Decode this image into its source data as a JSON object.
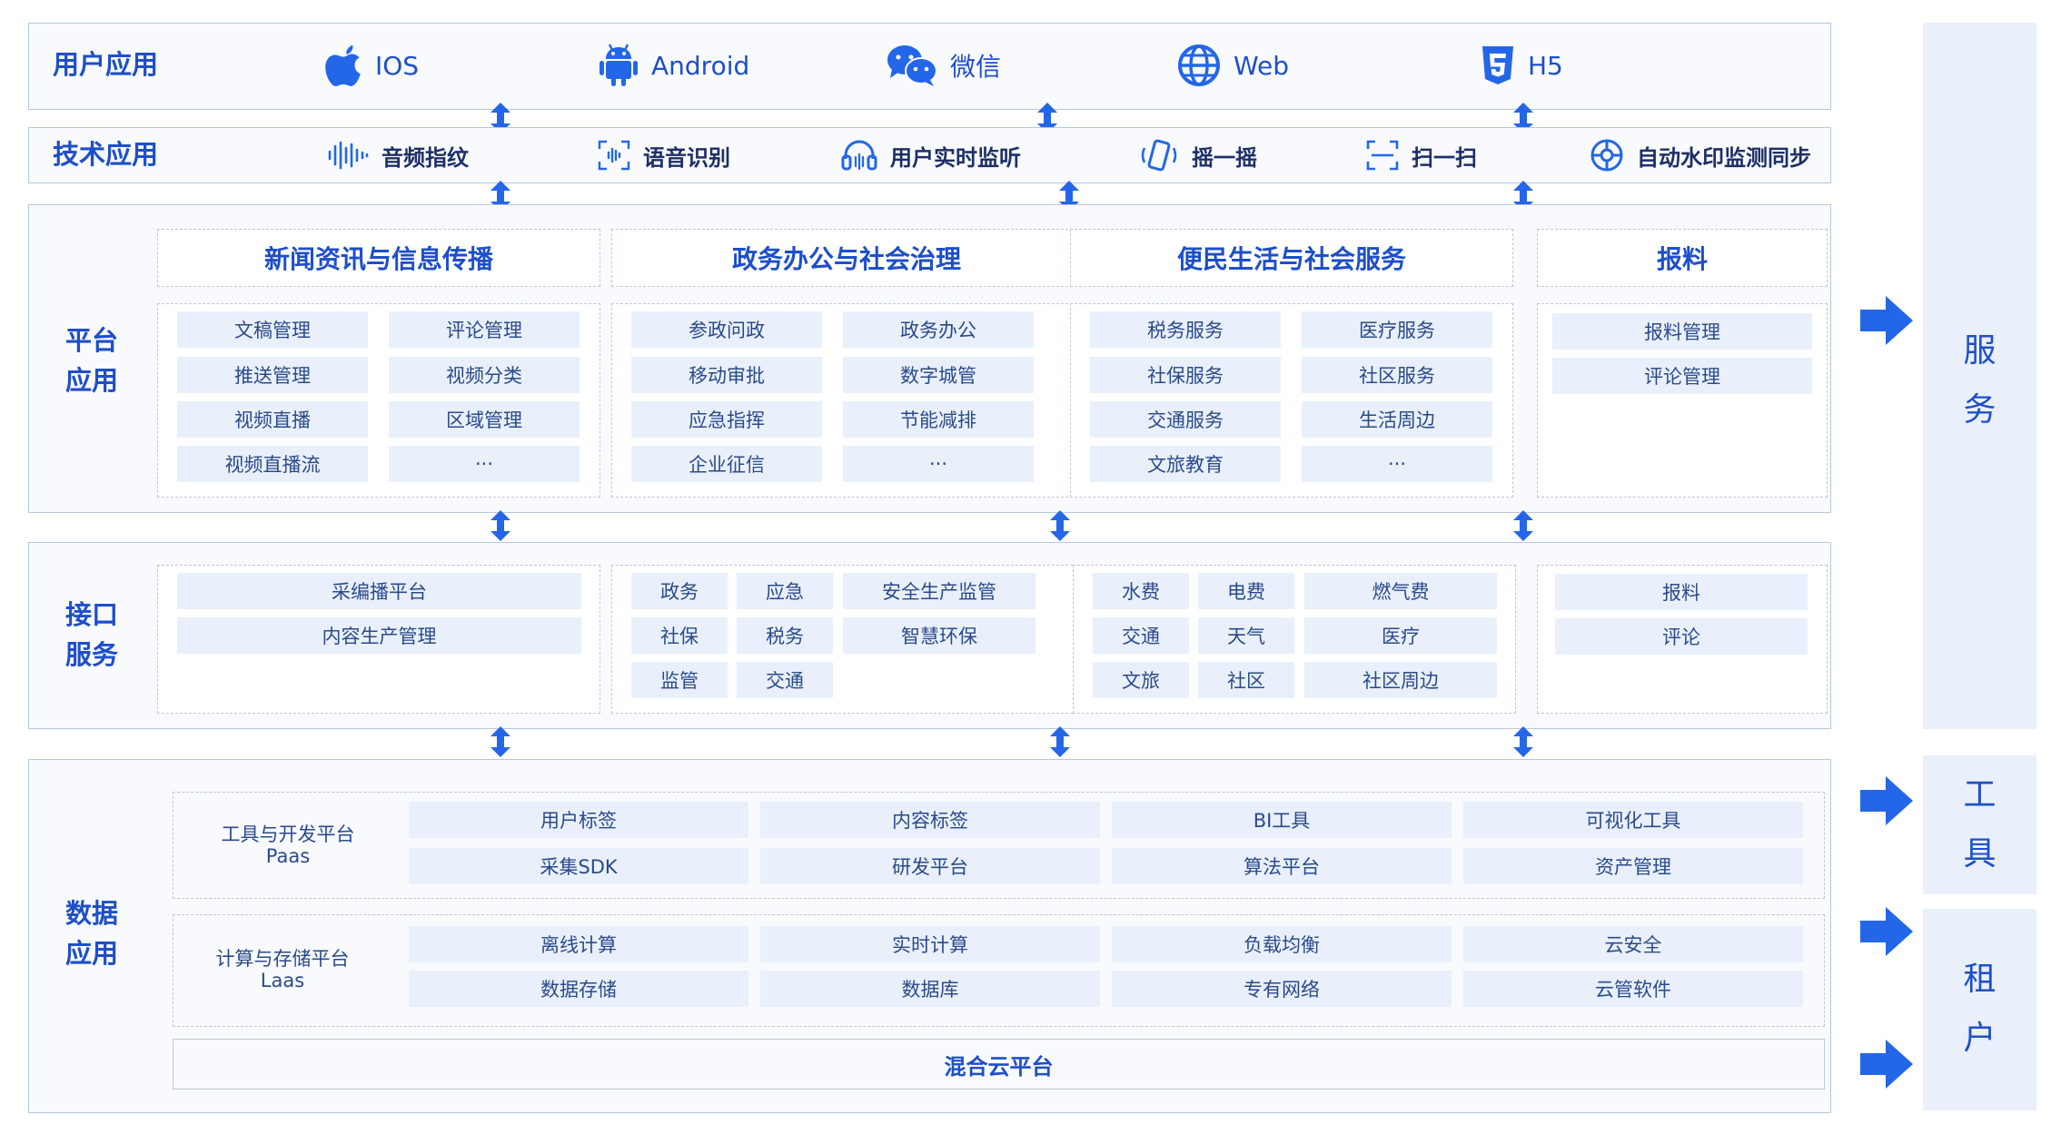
{
  "rows": {
    "user_app": {
      "label": "用户应用",
      "items": [
        {
          "icon": "apple-icon",
          "label": "IOS"
        },
        {
          "icon": "android-icon",
          "label": "Android"
        },
        {
          "icon": "wechat-icon",
          "label": "微信"
        },
        {
          "icon": "globe-icon",
          "label": "Web"
        },
        {
          "icon": "html5-icon",
          "label": "H5"
        }
      ]
    },
    "tech_app": {
      "label": "技术应用",
      "items": [
        {
          "icon": "audio-wave-icon",
          "label": "音频指纹"
        },
        {
          "icon": "voice-scan-icon",
          "label": "语音识别"
        },
        {
          "icon": "headset-icon",
          "label": "用户实时监听"
        },
        {
          "icon": "shake-phone-icon",
          "label": "摇一摇"
        },
        {
          "icon": "scan-icon",
          "label": "扫一扫"
        },
        {
          "icon": "watermark-icon",
          "label": "自动水印监测同步"
        }
      ]
    },
    "platform": {
      "label_line1": "平台",
      "label_line2": "应用",
      "groups": [
        {
          "title": "新闻资讯与信息传播",
          "cells": [
            "文稿管理",
            "评论管理",
            "推送管理",
            "视频分类",
            "视频直播",
            "区域管理",
            "视频直播流",
            "···"
          ]
        },
        {
          "title": "政务办公与社会治理",
          "cells": [
            "参政问政",
            "政务办公",
            "移动审批",
            "数字城管",
            "应急指挥",
            "节能减排",
            "企业征信",
            "···"
          ]
        },
        {
          "title": "便民生活与社会服务",
          "cells": [
            "税务服务",
            "医疗服务",
            "社保服务",
            "社区服务",
            "交通服务",
            "生活周边",
            "文旅教育",
            "···"
          ]
        },
        {
          "title": "报料",
          "cells": [
            "报料管理",
            "评论管理"
          ]
        }
      ]
    },
    "interface": {
      "label_line1": "接口",
      "label_line2": "服务",
      "g1": [
        "采编播平台",
        "内容生产管理"
      ],
      "g2": [
        "政务",
        "应急",
        "安全生产监管",
        "社保",
        "税务",
        "智慧环保",
        "监管",
        "交通"
      ],
      "g3": [
        "水费",
        "电费",
        "燃气费",
        "交通",
        "天气",
        "医疗",
        "文旅",
        "社区",
        "社区周边"
      ],
      "g4": [
        "报料",
        "评论"
      ]
    },
    "data": {
      "label_line1": "数据",
      "label_line2": "应用",
      "tools": {
        "label1": "工具与开发平台",
        "label2": "Paas",
        "cells": [
          "用户标签",
          "内容标签",
          "BI工具",
          "可视化工具",
          "采集SDK",
          "研发平台",
          "算法平台",
          "资产管理"
        ]
      },
      "compute": {
        "label1": "计算与存储平台",
        "label2": "Laas",
        "cells": [
          "离线计算",
          "实时计算",
          "负载均衡",
          "云安全",
          "数据存储",
          "数据库",
          "专有网络",
          "云管软件"
        ]
      },
      "hybrid": "混合云平台"
    }
  },
  "side": {
    "service": [
      "服",
      "务"
    ],
    "tools": [
      "工",
      "具"
    ],
    "tenant": [
      "租",
      "户"
    ]
  },
  "colors": {
    "accent": "#1e4fc9",
    "arrow": "#2466e8",
    "cell_bg": "#e9f0fc",
    "border": "#b9c6dd"
  }
}
